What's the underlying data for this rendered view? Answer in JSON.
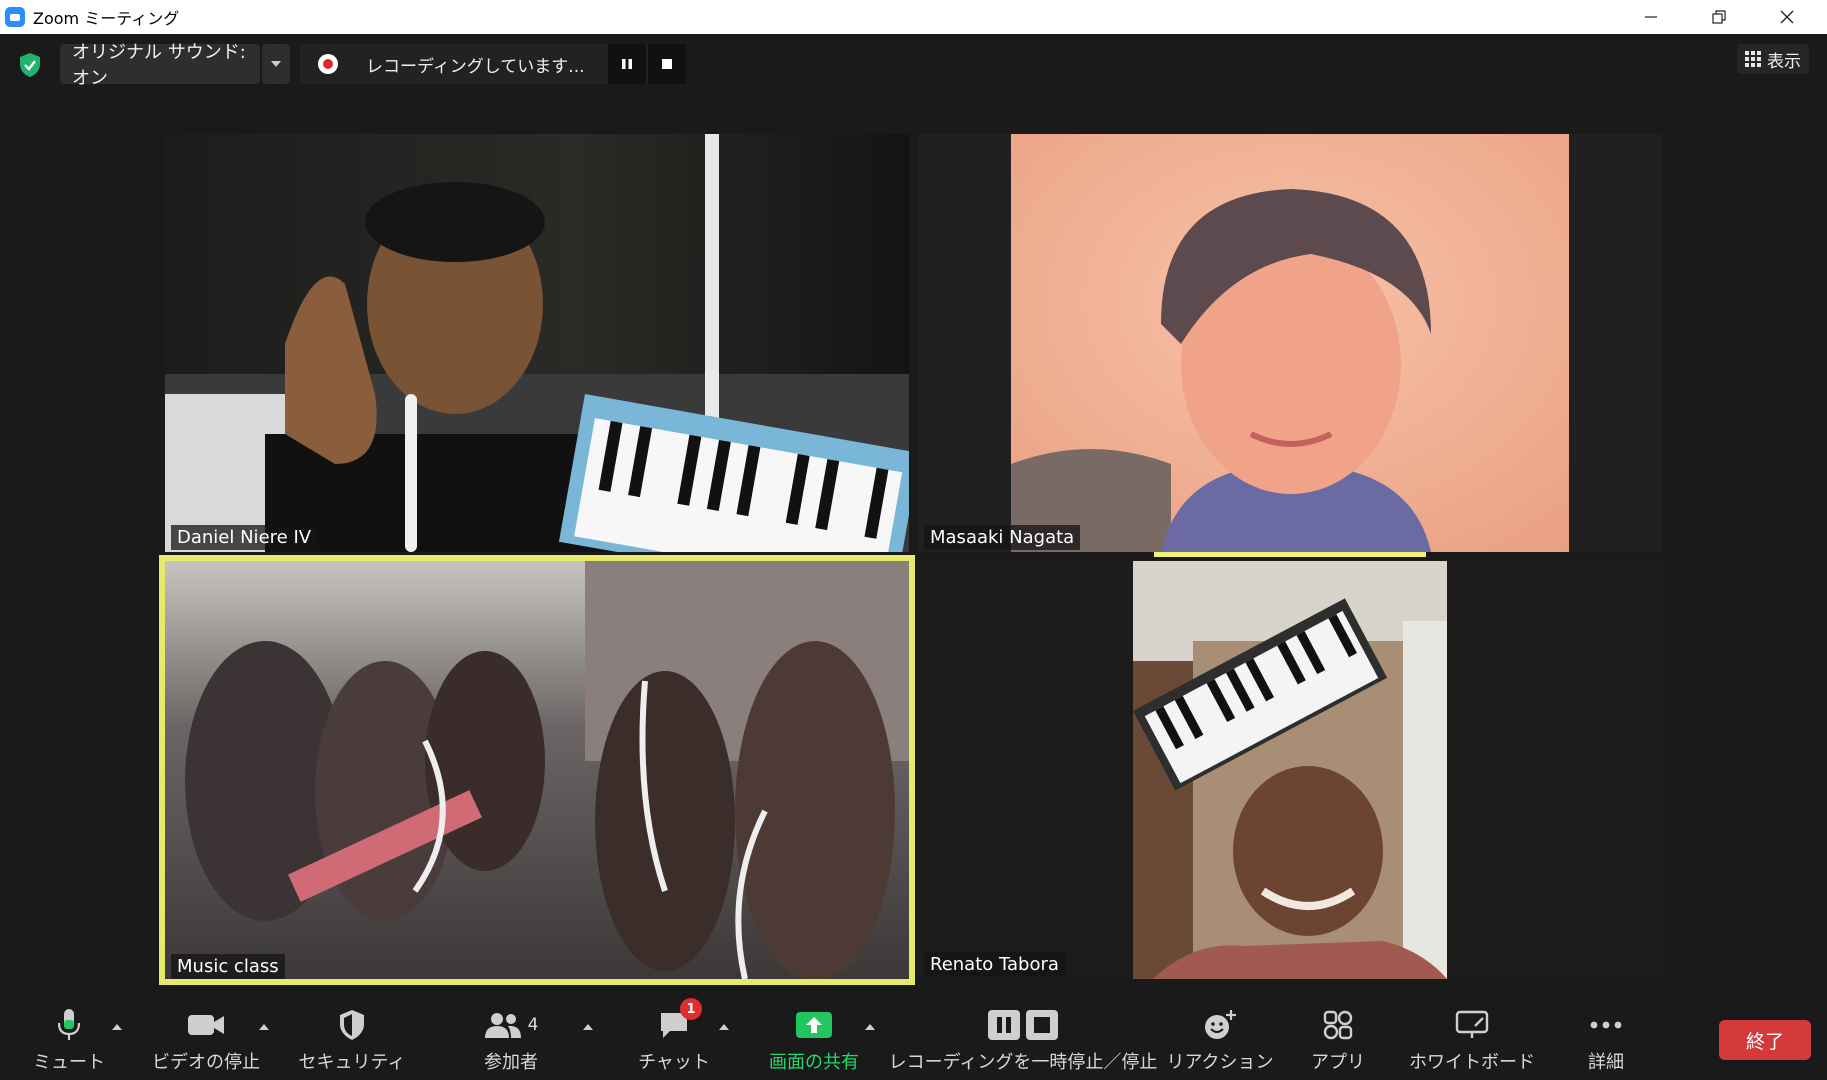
{
  "window": {
    "title": "Zoom ミーティング",
    "controls": [
      "minimize",
      "restore",
      "close"
    ]
  },
  "topbar": {
    "audio_label": "オリジナル サウンド: オン",
    "recording_label": "レコーディングしています...",
    "view_label": "表示"
  },
  "participants": [
    {
      "name": "Daniel Niere IV"
    },
    {
      "name": "Masaaki Nagata"
    },
    {
      "name": "Music class"
    },
    {
      "name": "Renato Tabora"
    }
  ],
  "toolbar": {
    "mute": "ミュート",
    "stop_video": "ビデオの停止",
    "security": "セキュリティ",
    "participants": "参加者",
    "participants_count": "4",
    "chat": "チャット",
    "chat_badge": "1",
    "share": "画面の共有",
    "recording_control": "レコーディングを一時停止／停止",
    "reactions": "リアクション",
    "apps": "アプリ",
    "whiteboard": "ホワイトボード",
    "more": "詳細",
    "end": "終了"
  },
  "colors": {
    "accent_blue": "#2d8cff",
    "share_green": "#22c55e",
    "end_red": "#d43a3a",
    "active_speaker": "#f2f275",
    "security_green": "#23b26d"
  }
}
